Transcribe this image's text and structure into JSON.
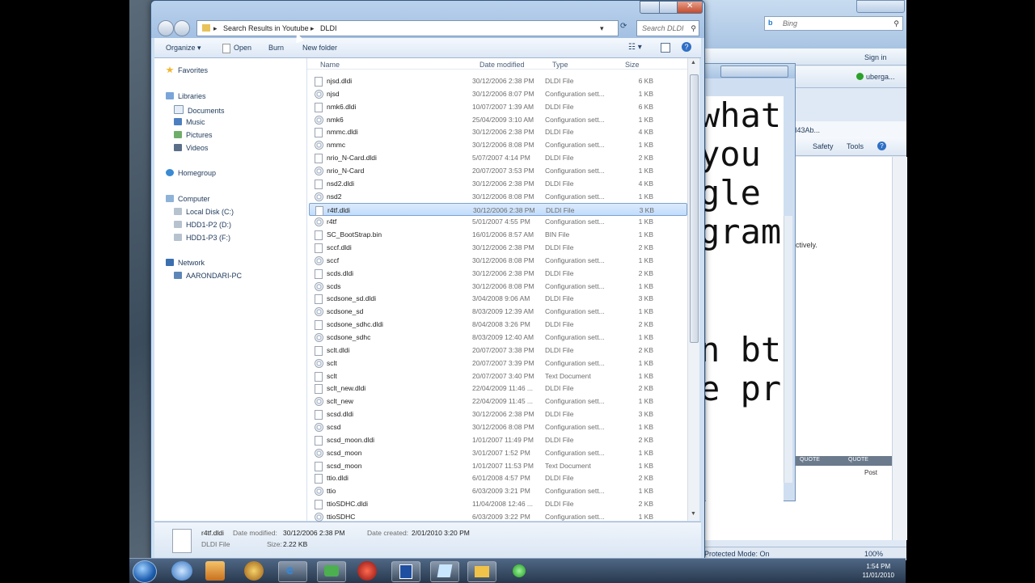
{
  "explorer": {
    "breadcrumb": [
      "Search Results in Youtube",
      "DLDI"
    ],
    "search_placeholder": "Search DLDI",
    "toolbar": {
      "organize": "Organize",
      "open": "Open",
      "burn": "Burn",
      "new_folder": "New folder"
    },
    "nav": {
      "favorites": "Favorites",
      "libraries": "Libraries",
      "documents": "Documents",
      "music": "Music",
      "pictures": "Pictures",
      "videos": "Videos",
      "homegroup": "Homegroup",
      "computer": "Computer",
      "drive_c": "Local Disk (C:)",
      "drive_d": "HDD1-P2 (D:)",
      "drive_f": "HDD1-P3 (F:)",
      "network": "Network",
      "network_pc": "AARONDARI-PC"
    },
    "columns": {
      "name": "Name",
      "date": "Date modified",
      "type": "Type",
      "size": "Size"
    },
    "files": [
      {
        "name": "njsd.dldi",
        "date": "30/12/2006 2:38 PM",
        "type": "DLDI File",
        "size": "6 KB",
        "kind": "doc"
      },
      {
        "name": "njsd",
        "date": "30/12/2006 8:07 PM",
        "type": "Configuration sett...",
        "size": "1 KB",
        "kind": "cfg"
      },
      {
        "name": "nmk6.dldi",
        "date": "10/07/2007 1:39 AM",
        "type": "DLDI File",
        "size": "6 KB",
        "kind": "doc"
      },
      {
        "name": "nmk6",
        "date": "25/04/2009 3:10 AM",
        "type": "Configuration sett...",
        "size": "1 KB",
        "kind": "cfg"
      },
      {
        "name": "nmmc.dldi",
        "date": "30/12/2006 2:38 PM",
        "type": "DLDI File",
        "size": "4 KB",
        "kind": "doc"
      },
      {
        "name": "nmmc",
        "date": "30/12/2006 8:08 PM",
        "type": "Configuration sett...",
        "size": "1 KB",
        "kind": "cfg"
      },
      {
        "name": "nrio_N-Card.dldi",
        "date": "5/07/2007 4:14 PM",
        "type": "DLDI File",
        "size": "2 KB",
        "kind": "doc"
      },
      {
        "name": "nrio_N-Card",
        "date": "20/07/2007 3:53 PM",
        "type": "Configuration sett...",
        "size": "1 KB",
        "kind": "cfg"
      },
      {
        "name": "nsd2.dldi",
        "date": "30/12/2006 2:38 PM",
        "type": "DLDI File",
        "size": "4 KB",
        "kind": "doc"
      },
      {
        "name": "nsd2",
        "date": "30/12/2006 8:08 PM",
        "type": "Configuration sett...",
        "size": "1 KB",
        "kind": "cfg"
      },
      {
        "name": "r4tf.dldi",
        "date": "30/12/2006 2:38 PM",
        "type": "DLDI File",
        "size": "3 KB",
        "kind": "doc",
        "selected": true
      },
      {
        "name": "r4tf",
        "date": "5/01/2007 4:55 PM",
        "type": "Configuration sett...",
        "size": "1 KB",
        "kind": "cfg"
      },
      {
        "name": "SC_BootStrap.bin",
        "date": "16/01/2006 8:57 AM",
        "type": "BIN File",
        "size": "1 KB",
        "kind": "doc"
      },
      {
        "name": "sccf.dldi",
        "date": "30/12/2006 2:38 PM",
        "type": "DLDI File",
        "size": "2 KB",
        "kind": "doc"
      },
      {
        "name": "sccf",
        "date": "30/12/2006 8:08 PM",
        "type": "Configuration sett...",
        "size": "1 KB",
        "kind": "cfg"
      },
      {
        "name": "scds.dldi",
        "date": "30/12/2006 2:38 PM",
        "type": "DLDI File",
        "size": "2 KB",
        "kind": "doc"
      },
      {
        "name": "scds",
        "date": "30/12/2006 8:08 PM",
        "type": "Configuration sett...",
        "size": "1 KB",
        "kind": "cfg"
      },
      {
        "name": "scdsone_sd.dldi",
        "date": "3/04/2008 9:06 AM",
        "type": "DLDI File",
        "size": "3 KB",
        "kind": "doc"
      },
      {
        "name": "scdsone_sd",
        "date": "8/03/2009 12:39 AM",
        "type": "Configuration sett...",
        "size": "1 KB",
        "kind": "cfg"
      },
      {
        "name": "scdsone_sdhc.dldi",
        "date": "8/04/2008 3:26 PM",
        "type": "DLDI File",
        "size": "2 KB",
        "kind": "doc"
      },
      {
        "name": "scdsone_sdhc",
        "date": "8/03/2009 12:40 AM",
        "type": "Configuration sett...",
        "size": "1 KB",
        "kind": "cfg"
      },
      {
        "name": "sclt.dldi",
        "date": "20/07/2007 3:38 PM",
        "type": "DLDI File",
        "size": "2 KB",
        "kind": "doc"
      },
      {
        "name": "sclt",
        "date": "20/07/2007 3:39 PM",
        "type": "Configuration sett...",
        "size": "1 KB",
        "kind": "cfg"
      },
      {
        "name": "sclt",
        "date": "20/07/2007 3:40 PM",
        "type": "Text Document",
        "size": "1 KB",
        "kind": "doc"
      },
      {
        "name": "sclt_new.dldi",
        "date": "22/04/2009 11:46 ...",
        "type": "DLDI File",
        "size": "2 KB",
        "kind": "doc"
      },
      {
        "name": "sclt_new",
        "date": "22/04/2009 11:45 ...",
        "type": "Configuration sett...",
        "size": "1 KB",
        "kind": "cfg"
      },
      {
        "name": "scsd.dldi",
        "date": "30/12/2006 2:38 PM",
        "type": "DLDI File",
        "size": "3 KB",
        "kind": "doc"
      },
      {
        "name": "scsd",
        "date": "30/12/2006 8:08 PM",
        "type": "Configuration sett...",
        "size": "1 KB",
        "kind": "cfg"
      },
      {
        "name": "scsd_moon.dldi",
        "date": "1/01/2007 11:49 PM",
        "type": "DLDI File",
        "size": "2 KB",
        "kind": "doc"
      },
      {
        "name": "scsd_moon",
        "date": "3/01/2007 1:52 PM",
        "type": "Configuration sett...",
        "size": "1 KB",
        "kind": "cfg"
      },
      {
        "name": "scsd_moon",
        "date": "1/01/2007 11:53 PM",
        "type": "Text Document",
        "size": "1 KB",
        "kind": "doc"
      },
      {
        "name": "ttio.dldi",
        "date": "6/01/2008 4:57 PM",
        "type": "DLDI File",
        "size": "2 KB",
        "kind": "doc"
      },
      {
        "name": "ttio",
        "date": "6/03/2009 3:21 PM",
        "type": "Configuration sett...",
        "size": "1 KB",
        "kind": "cfg"
      },
      {
        "name": "ttioSDHC.dldi",
        "date": "11/04/2008 12:46 ...",
        "type": "DLDI File",
        "size": "2 KB",
        "kind": "doc"
      },
      {
        "name": "ttioSDHC",
        "date": "6/03/2009 3:22 PM",
        "type": "Configuration sett...",
        "size": "1 KB",
        "kind": "cfg"
      }
    ],
    "details": {
      "name": "r4tf.dldi",
      "type": "DLDI File",
      "modified_label": "Date modified:",
      "modified": "30/12/2006 2:38 PM",
      "created_label": "Date created:",
      "created": "2/01/2010 3:20 PM",
      "size_label": "Size:",
      "size": "2.22 KB"
    }
  },
  "ie": {
    "search_placeholder": "Bing",
    "sign_in": "Sign in",
    "user": "uberga...",
    "safety": "Safety",
    "tools": "Tools",
    "tab_text": "I43Ab...",
    "content_snippet": "ectively.",
    "post": "Post",
    "quote1": "QUOTE",
    "quote2": "QUOTE",
    "status": "Protected Mode: On",
    "zoom": "100%"
  },
  "editor": {
    "lines": [
      "what",
      "you",
      "gle",
      "gram",
      "",
      "n bt",
      "e pr"
    ]
  },
  "taskbar": {
    "time": "1:54 PM",
    "date": "11/01/2010"
  },
  "colors": {
    "explorer_frame": "#cddff2",
    "selection": "#c1dcfc",
    "taskbar": "#27384d"
  }
}
